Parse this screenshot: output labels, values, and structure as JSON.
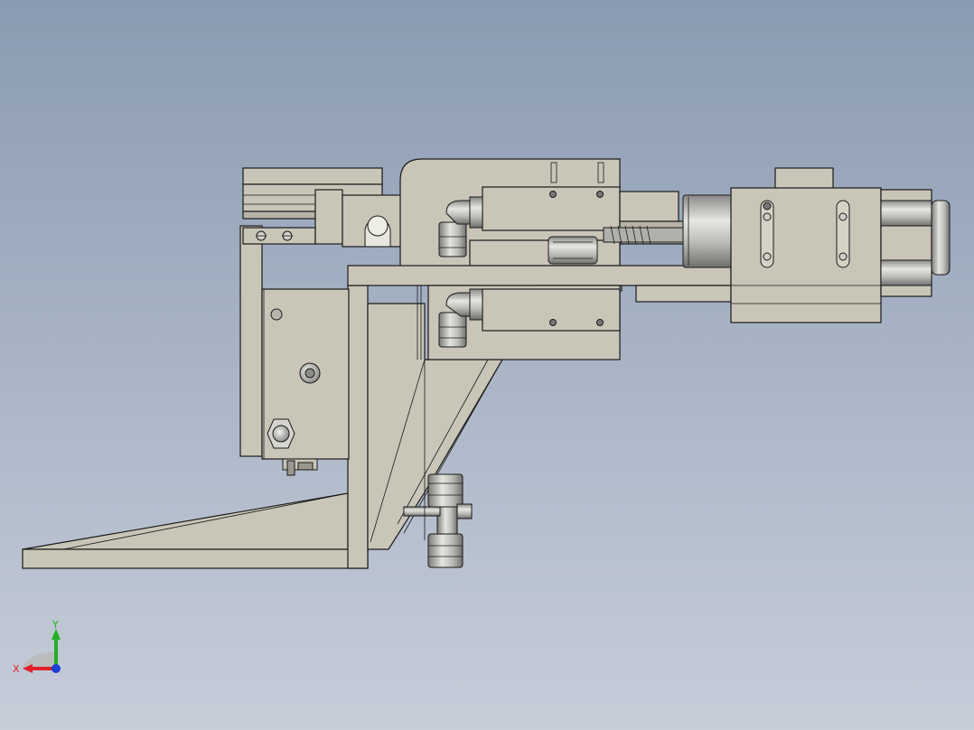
{
  "viewport": {
    "background_top": "#8a9bb1",
    "background_bottom": "#c7cdd9",
    "model_fill": "#c9c6b8",
    "edge_color": "#1a1a1a"
  },
  "triad": {
    "x_label": "X",
    "y_label": "Y",
    "x_color": "#e0202a",
    "y_color": "#22b022",
    "z_color": "#1a3fd6"
  }
}
